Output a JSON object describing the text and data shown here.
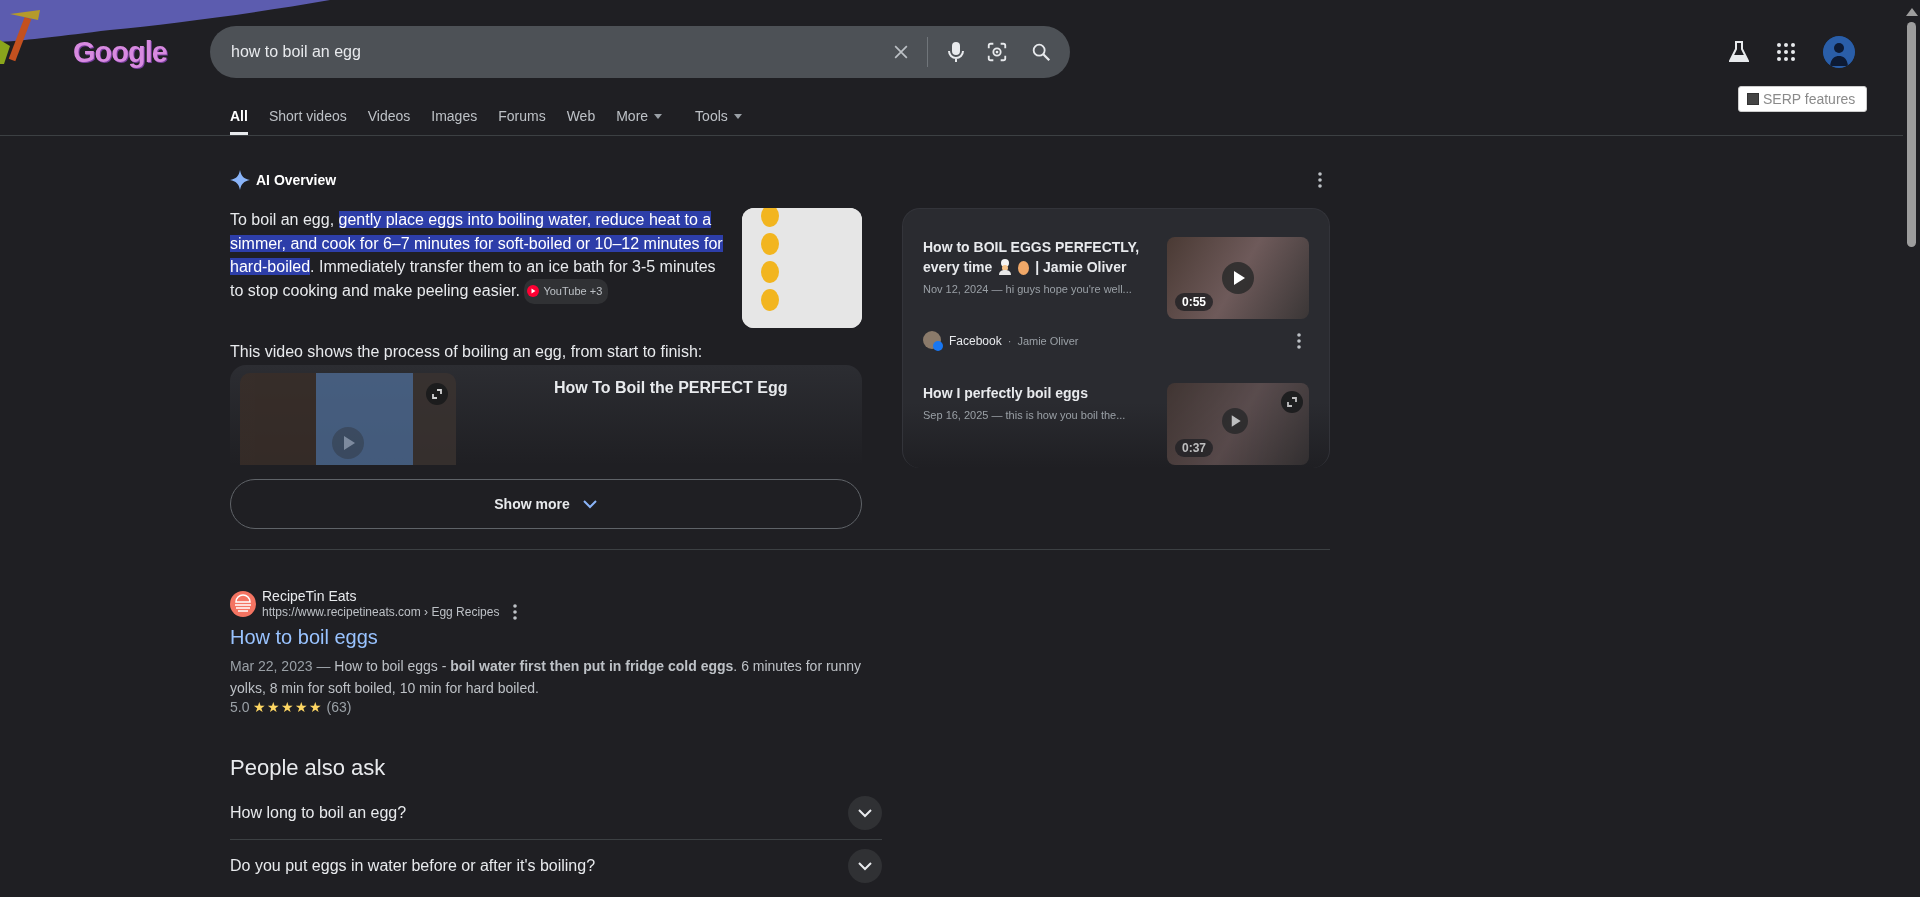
{
  "logo": {
    "text": "Google"
  },
  "search": {
    "value": "how to boil an egg"
  },
  "tabs": [
    {
      "label": "All",
      "selected": true,
      "menu": false
    },
    {
      "label": "Short videos",
      "selected": false,
      "menu": false
    },
    {
      "label": "Videos",
      "selected": false,
      "menu": false
    },
    {
      "label": "Images",
      "selected": false,
      "menu": false
    },
    {
      "label": "Forums",
      "selected": false,
      "menu": false
    },
    {
      "label": "Web",
      "selected": false,
      "menu": false
    },
    {
      "label": "More",
      "selected": false,
      "menu": true
    },
    {
      "label": "Tools",
      "selected": false,
      "menu": true
    }
  ],
  "serp_features": {
    "label": "SERP features",
    "checked": false
  },
  "ai_overview": {
    "title": "AI Overview",
    "summary_start": "To boil an egg, ",
    "summary_highlight": "gently place eggs into boiling water, reduce heat to a simmer, and cook for 6–7 minutes for soft-boiled or 10–12 minutes for hard-boiled",
    "summary_end": ". Immediately transfer them to an ice bath for 3-5 minutes to stop cooking and make peeling easier.",
    "source_chip": "YouTube +3",
    "video_intro": "This video shows the process of boiling an egg, from start to finish:",
    "video_title": "How To Boil the PERFECT Egg",
    "show_more": "Show more"
  },
  "side_videos": [
    {
      "title": "How to BOIL EGGS PERFECTLY,",
      "title_line2": "every time",
      "emoji_icons": true,
      "title_end": "| Jamie Oliver",
      "snippet": "Nov 12, 2024 — hi guys hope you're well...",
      "duration": "0:55",
      "source": "Facebook",
      "separator": "·",
      "author": "Jamie Oliver"
    },
    {
      "title": "How I perfectly boil eggs",
      "emoji_icons": false,
      "snippet": "Sep 16, 2025 — this is how you boil the...",
      "duration": "0:37"
    }
  ],
  "result": {
    "site": "RecipeTin Eats",
    "url": "https://www.recipetineats.com › Egg Recipes",
    "title": "How to boil eggs",
    "date": "Mar 22, 2023 —",
    "snippet": "How to boil eggs - **boil water first then put in fridge cold eggs**. 6 minutes for runny yolks, 8 min for soft boiled, 10 min for hard boiled.",
    "rating": "5.0",
    "stars": 5,
    "reviews": "(63)"
  },
  "people_also_ask": {
    "title": "People also ask",
    "questions": [
      {
        "text": "How long to boil an egg?",
        "expanded": false
      },
      {
        "text": "Do you put eggs in water before or after it's boiling?",
        "expanded": false
      }
    ]
  }
}
